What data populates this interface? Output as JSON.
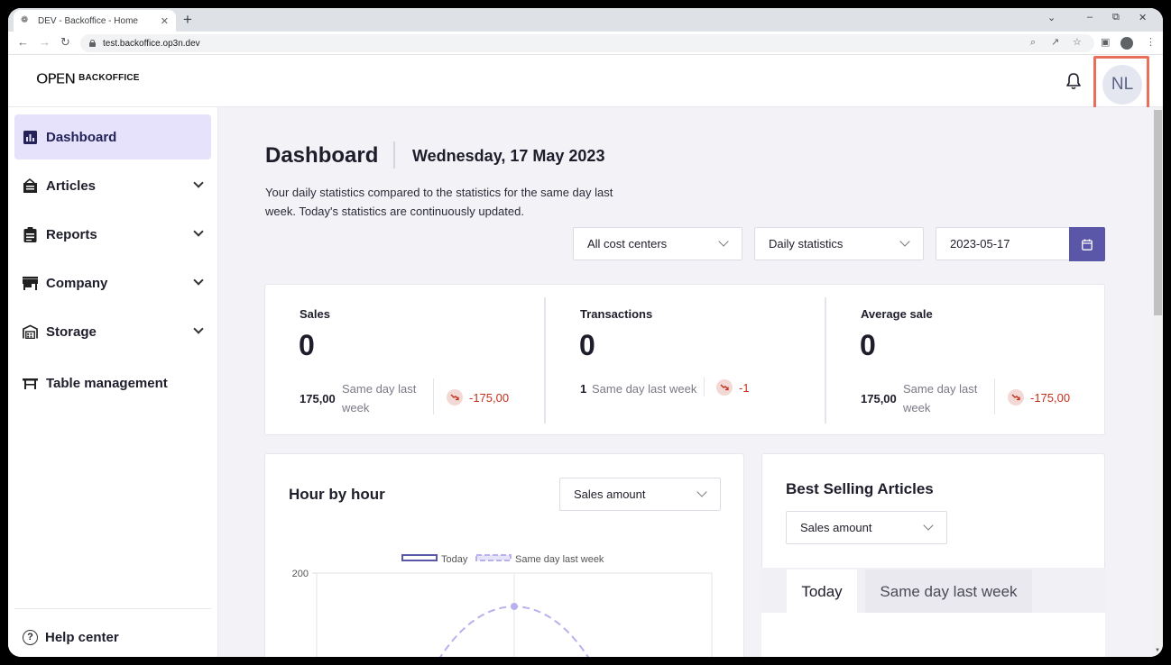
{
  "browser": {
    "tab_title": "DEV - Backoffice - Home",
    "url": "test.backoffice.op3n.dev"
  },
  "header": {
    "logo_mark": "OPEN",
    "logo_text": "BACKOFFICE",
    "avatar_initials": "NL",
    "highlight_color": "#e8705a"
  },
  "sidebar": {
    "items": [
      {
        "label": "Dashboard",
        "icon": "bar-chart-icon",
        "active": true
      },
      {
        "label": "Articles",
        "icon": "articles-icon"
      },
      {
        "label": "Reports",
        "icon": "clipboard-icon"
      },
      {
        "label": "Company",
        "icon": "store-icon"
      },
      {
        "label": "Storage",
        "icon": "warehouse-icon"
      },
      {
        "label": "Table management",
        "icon": "table-icon"
      }
    ],
    "help_label": "Help center"
  },
  "main": {
    "title": "Dashboard",
    "date": "Wednesday, 17 May 2023",
    "subtitle_line1": "Your daily statistics compared to the statistics for the same day last",
    "subtitle_line2": "week. Today's statistics are continuously updated.",
    "filters": {
      "cost_center": "All cost centers",
      "period": "Daily statistics",
      "date": "2023-05-17"
    },
    "stats": [
      {
        "label": "Sales",
        "value": "0",
        "prev_value": "175,00",
        "prev_label_1": "Same day last",
        "prev_label_2": "week",
        "diff": "-175,00"
      },
      {
        "label": "Transactions",
        "value": "0",
        "prev_value": "1",
        "prev_label_1": "Same day last week",
        "prev_label_2": "",
        "diff": "-1"
      },
      {
        "label": "Average sale",
        "value": "0",
        "prev_value": "175,00",
        "prev_label_1": "Same day last",
        "prev_label_2": "week",
        "diff": "-175,00"
      }
    ],
    "hour_by_hour": {
      "title": "Hour by hour",
      "select": "Sales amount"
    },
    "best_selling": {
      "title": "Best Selling Articles",
      "select": "Sales amount",
      "tab_today": "Today",
      "tab_last": "Same day last week"
    }
  },
  "chart_data": {
    "type": "line",
    "series": [
      {
        "name": "Today",
        "values": []
      },
      {
        "name": "Same day last week",
        "peak": 175
      }
    ],
    "ytick_labels": [
      "200"
    ],
    "colors": {
      "today": "#5b57a8",
      "last_week": "#b7b2ee"
    }
  }
}
